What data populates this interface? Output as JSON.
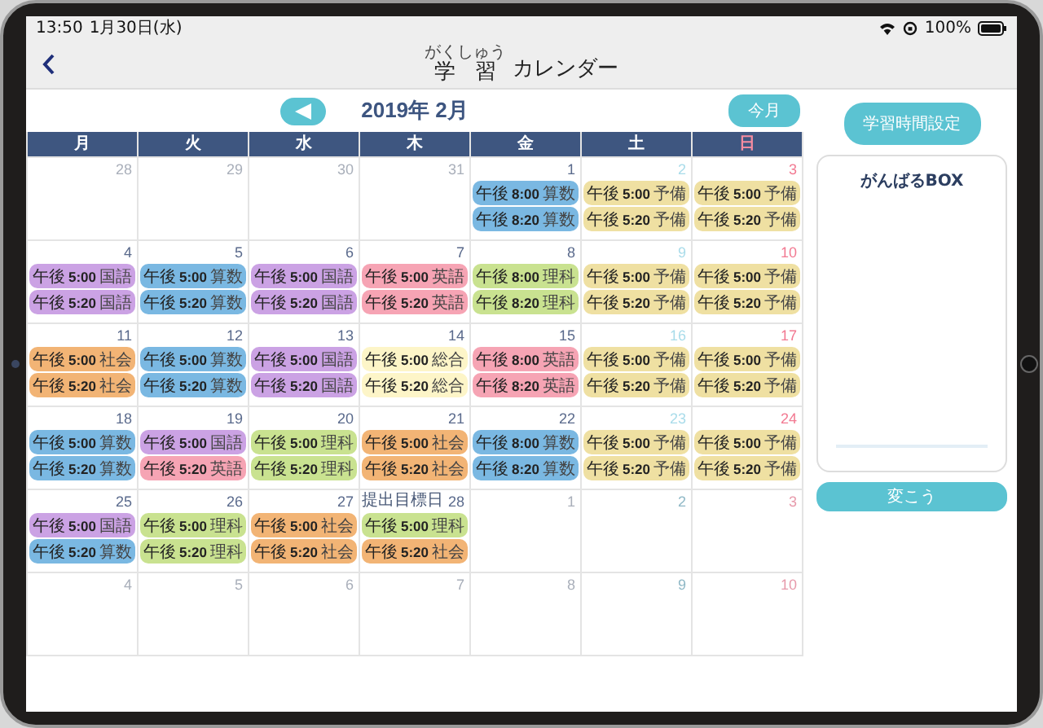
{
  "status_bar": {
    "time": "13:50",
    "date": "1月30日(水)",
    "battery": "100%"
  },
  "nav": {
    "title_base": "学習",
    "title_ruby": "がくしゅう",
    "title_rest": "カレンダー"
  },
  "month": {
    "title": "2019年 2月",
    "today_button": "今月"
  },
  "weekdays": [
    "月",
    "火",
    "水",
    "木",
    "金",
    "土",
    "日"
  ],
  "weeks": [
    [
      {
        "day": "28",
        "in_month": false
      },
      {
        "day": "29",
        "in_month": false
      },
      {
        "day": "30",
        "in_month": false
      },
      {
        "day": "31",
        "in_month": false
      },
      {
        "day": "1",
        "in_month": true,
        "events": [
          {
            "period": "午後",
            "time": "8:00",
            "subject": "算数",
            "color": "#7ab8e2"
          },
          {
            "period": "午後",
            "time": "8:20",
            "subject": "算数",
            "color": "#7ab8e2"
          }
        ]
      },
      {
        "day": "2",
        "in_month": true,
        "events": [
          {
            "period": "午後",
            "time": "5:00",
            "subject": "予備",
            "color": "#efe0a2"
          },
          {
            "period": "午後",
            "time": "5:20",
            "subject": "予備",
            "color": "#efe0a2"
          }
        ]
      },
      {
        "day": "3",
        "in_month": true,
        "events": [
          {
            "period": "午後",
            "time": "5:00",
            "subject": "予備",
            "color": "#efe0a2"
          },
          {
            "period": "午後",
            "time": "5:20",
            "subject": "予備",
            "color": "#efe0a2"
          }
        ]
      }
    ],
    [
      {
        "day": "4",
        "in_month": true,
        "events": [
          {
            "period": "午後",
            "time": "5:00",
            "subject": "国語",
            "color": "#cba2e4"
          },
          {
            "period": "午後",
            "time": "5:20",
            "subject": "国語",
            "color": "#cba2e4"
          }
        ]
      },
      {
        "day": "5",
        "in_month": true,
        "events": [
          {
            "period": "午後",
            "time": "5:00",
            "subject": "算数",
            "color": "#7ab8e2"
          },
          {
            "period": "午後",
            "time": "5:20",
            "subject": "算数",
            "color": "#7ab8e2"
          }
        ]
      },
      {
        "day": "6",
        "in_month": true,
        "events": [
          {
            "period": "午後",
            "time": "5:00",
            "subject": "国語",
            "color": "#cba2e4"
          },
          {
            "period": "午後",
            "time": "5:20",
            "subject": "国語",
            "color": "#cba2e4"
          }
        ]
      },
      {
        "day": "7",
        "in_month": true,
        "events": [
          {
            "period": "午後",
            "time": "5:00",
            "subject": "英語",
            "color": "#f6a4b4"
          },
          {
            "period": "午後",
            "time": "5:20",
            "subject": "英語",
            "color": "#f6a4b4"
          }
        ]
      },
      {
        "day": "8",
        "in_month": true,
        "events": [
          {
            "period": "午後",
            "time": "8:00",
            "subject": "理科",
            "color": "#c9e290"
          },
          {
            "period": "午後",
            "time": "8:20",
            "subject": "理科",
            "color": "#c9e290"
          }
        ]
      },
      {
        "day": "9",
        "in_month": true,
        "events": [
          {
            "period": "午後",
            "time": "5:00",
            "subject": "予備",
            "color": "#efe0a2"
          },
          {
            "period": "午後",
            "time": "5:20",
            "subject": "予備",
            "color": "#efe0a2"
          }
        ]
      },
      {
        "day": "10",
        "in_month": true,
        "events": [
          {
            "period": "午後",
            "time": "5:00",
            "subject": "予備",
            "color": "#efe0a2"
          },
          {
            "period": "午後",
            "time": "5:20",
            "subject": "予備",
            "color": "#efe0a2"
          }
        ]
      }
    ],
    [
      {
        "day": "11",
        "in_month": true,
        "events": [
          {
            "period": "午後",
            "time": "5:00",
            "subject": "社会",
            "color": "#f2b475"
          },
          {
            "period": "午後",
            "time": "5:20",
            "subject": "社会",
            "color": "#f2b475"
          }
        ]
      },
      {
        "day": "12",
        "in_month": true,
        "events": [
          {
            "period": "午後",
            "time": "5:00",
            "subject": "算数",
            "color": "#7ab8e2"
          },
          {
            "period": "午後",
            "time": "5:20",
            "subject": "算数",
            "color": "#7ab8e2"
          }
        ]
      },
      {
        "day": "13",
        "in_month": true,
        "events": [
          {
            "period": "午後",
            "time": "5:00",
            "subject": "国語",
            "color": "#cba2e4"
          },
          {
            "period": "午後",
            "time": "5:20",
            "subject": "国語",
            "color": "#cba2e4"
          }
        ]
      },
      {
        "day": "14",
        "in_month": true,
        "events": [
          {
            "period": "午後",
            "time": "5:00",
            "subject": "総合",
            "color": "#fdf5c8"
          },
          {
            "period": "午後",
            "time": "5:20",
            "subject": "総合",
            "color": "#fdf5c8"
          }
        ]
      },
      {
        "day": "15",
        "in_month": true,
        "events": [
          {
            "period": "午後",
            "time": "8:00",
            "subject": "英語",
            "color": "#f6a4b4"
          },
          {
            "period": "午後",
            "time": "8:20",
            "subject": "英語",
            "color": "#f6a4b4"
          }
        ]
      },
      {
        "day": "16",
        "in_month": true,
        "events": [
          {
            "period": "午後",
            "time": "5:00",
            "subject": "予備",
            "color": "#efe0a2"
          },
          {
            "period": "午後",
            "time": "5:20",
            "subject": "予備",
            "color": "#efe0a2"
          }
        ]
      },
      {
        "day": "17",
        "in_month": true,
        "events": [
          {
            "period": "午後",
            "time": "5:00",
            "subject": "予備",
            "color": "#efe0a2"
          },
          {
            "period": "午後",
            "time": "5:20",
            "subject": "予備",
            "color": "#efe0a2"
          }
        ]
      }
    ],
    [
      {
        "day": "18",
        "in_month": true,
        "events": [
          {
            "period": "午後",
            "time": "5:00",
            "subject": "算数",
            "color": "#7ab8e2"
          },
          {
            "period": "午後",
            "time": "5:20",
            "subject": "算数",
            "color": "#7ab8e2"
          }
        ]
      },
      {
        "day": "19",
        "in_month": true,
        "events": [
          {
            "period": "午後",
            "time": "5:00",
            "subject": "国語",
            "color": "#cba2e4"
          },
          {
            "period": "午後",
            "time": "5:20",
            "subject": "英語",
            "color": "#f6a4b4"
          }
        ]
      },
      {
        "day": "20",
        "in_month": true,
        "events": [
          {
            "period": "午後",
            "time": "5:00",
            "subject": "理科",
            "color": "#c9e290"
          },
          {
            "period": "午後",
            "time": "5:20",
            "subject": "理科",
            "color": "#c9e290"
          }
        ]
      },
      {
        "day": "21",
        "in_month": true,
        "events": [
          {
            "period": "午後",
            "time": "5:00",
            "subject": "社会",
            "color": "#f2b475"
          },
          {
            "period": "午後",
            "time": "5:20",
            "subject": "社会",
            "color": "#f2b475"
          }
        ]
      },
      {
        "day": "22",
        "in_month": true,
        "events": [
          {
            "period": "午後",
            "time": "8:00",
            "subject": "算数",
            "color": "#7ab8e2"
          },
          {
            "period": "午後",
            "time": "8:20",
            "subject": "算数",
            "color": "#7ab8e2"
          }
        ]
      },
      {
        "day": "23",
        "in_month": true,
        "events": [
          {
            "period": "午後",
            "time": "5:00",
            "subject": "予備",
            "color": "#efe0a2"
          },
          {
            "period": "午後",
            "time": "5:20",
            "subject": "予備",
            "color": "#efe0a2"
          }
        ]
      },
      {
        "day": "24",
        "in_month": true,
        "events": [
          {
            "period": "午後",
            "time": "5:00",
            "subject": "予備",
            "color": "#efe0a2"
          },
          {
            "period": "午後",
            "time": "5:20",
            "subject": "予備",
            "color": "#efe0a2"
          }
        ]
      }
    ],
    [
      {
        "day": "25",
        "in_month": true,
        "events": [
          {
            "period": "午後",
            "time": "5:00",
            "subject": "国語",
            "color": "#cba2e4"
          },
          {
            "period": "午後",
            "time": "5:20",
            "subject": "算数",
            "color": "#7ab8e2"
          }
        ]
      },
      {
        "day": "26",
        "in_month": true,
        "events": [
          {
            "period": "午後",
            "time": "5:00",
            "subject": "理科",
            "color": "#c9e290"
          },
          {
            "period": "午後",
            "time": "5:20",
            "subject": "理科",
            "color": "#c9e290"
          }
        ]
      },
      {
        "day": "27",
        "in_month": true,
        "events": [
          {
            "period": "午後",
            "time": "5:00",
            "subject": "社会",
            "color": "#f2b475"
          },
          {
            "period": "午後",
            "time": "5:20",
            "subject": "社会",
            "color": "#f2b475"
          }
        ]
      },
      {
        "day": "28",
        "in_month": true,
        "label": "提出目標日",
        "events": [
          {
            "period": "午後",
            "time": "5:00",
            "subject": "理科",
            "color": "#c9e290"
          },
          {
            "period": "午後",
            "time": "5:20",
            "subject": "社会",
            "color": "#f2b475"
          }
        ]
      },
      {
        "day": "1",
        "in_month": false
      },
      {
        "day": "2",
        "in_month": false
      },
      {
        "day": "3",
        "in_month": false
      }
    ],
    [
      {
        "day": "4",
        "in_month": false
      },
      {
        "day": "5",
        "in_month": false
      },
      {
        "day": "6",
        "in_month": false
      },
      {
        "day": "7",
        "in_month": false
      },
      {
        "day": "8",
        "in_month": false
      },
      {
        "day": "9",
        "in_month": false
      },
      {
        "day": "10",
        "in_month": false
      }
    ]
  ],
  "sidebar": {
    "settings_button": "学習時間設定",
    "box_title": "がんばるBOX",
    "change_button": "変こう"
  }
}
